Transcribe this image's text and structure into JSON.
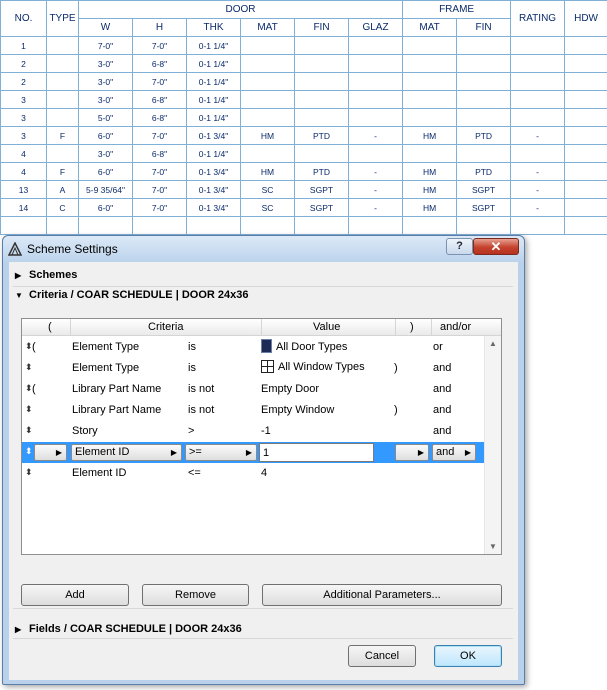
{
  "schedule": {
    "header_top": {
      "no": "NO.",
      "type": "TYPE",
      "door": "DOOR",
      "frame": "FRAME",
      "rating": "RATING",
      "hdw": "HDW"
    },
    "header_sub": [
      "W",
      "H",
      "THK",
      "MAT",
      "FIN",
      "GLAZ",
      "MAT",
      "FIN"
    ],
    "rows": [
      [
        "1",
        "",
        "7-0\"",
        "7-0\"",
        "0-1 1/4\"",
        "",
        "",
        "",
        "",
        "",
        "",
        ""
      ],
      [
        "2",
        "",
        "3-0\"",
        "6-8\"",
        "0-1 1/4\"",
        "",
        "",
        "",
        "",
        "",
        "",
        ""
      ],
      [
        "2",
        "",
        "3-0\"",
        "7-0\"",
        "0-1 1/4\"",
        "",
        "",
        "",
        "",
        "",
        "",
        ""
      ],
      [
        "3",
        "",
        "3-0\"",
        "6-8\"",
        "0-1 1/4\"",
        "",
        "",
        "",
        "",
        "",
        "",
        ""
      ],
      [
        "3",
        "",
        "5-0\"",
        "6-8\"",
        "0-1 1/4\"",
        "",
        "",
        "",
        "",
        "",
        "",
        ""
      ],
      [
        "3",
        "F",
        "6-0\"",
        "7-0\"",
        "0-1 3/4\"",
        "HM",
        "PTD",
        "-",
        "HM",
        "PTD",
        "-",
        ""
      ],
      [
        "4",
        "",
        "3-0\"",
        "6-8\"",
        "0-1 1/4\"",
        "",
        "",
        "",
        "",
        "",
        "",
        ""
      ],
      [
        "4",
        "F",
        "6-0\"",
        "7-0\"",
        "0-1 3/4\"",
        "HM",
        "PTD",
        "-",
        "HM",
        "PTD",
        "-",
        ""
      ],
      [
        "13",
        "A",
        "5-9 35/64\"",
        "7-0\"",
        "0-1 3/4\"",
        "SC",
        "SGPT",
        "-",
        "HM",
        "SGPT",
        "-",
        ""
      ],
      [
        "14",
        "C",
        "6-0\"",
        "7-0\"",
        "0-1 3/4\"",
        "SC",
        "SGPT",
        "-",
        "HM",
        "SGPT",
        "-",
        ""
      ],
      [
        "",
        "",
        "",
        "",
        "",
        "",
        "",
        "",
        "",
        "",
        "",
        ""
      ]
    ]
  },
  "dialog": {
    "title": "Scheme Settings",
    "help_label": "?",
    "close_label": "✕",
    "sections": {
      "schemes": "Schemes",
      "criteria": "Criteria /  COAR SCHEDULE | DOOR 24x36",
      "fields": "Fields /  COAR SCHEDULE | DOOR 24x36"
    },
    "list_header": {
      "open_paren": "(",
      "criteria": "Criteria",
      "value": "Value",
      "close_paren": ")",
      "andor": "and/or"
    },
    "rows": [
      {
        "open": "(",
        "field": "Element Type",
        "op": "is",
        "value": "All Door Types",
        "icon": "door-icon",
        "close": "",
        "andor": "or"
      },
      {
        "open": "",
        "field": "Element Type",
        "op": "is",
        "value": "All Window Types",
        "icon": "window-icon",
        "close": ")",
        "andor": "and"
      },
      {
        "open": "(",
        "field": "Library Part Name",
        "op": "is not",
        "value": "Empty Door",
        "icon": "",
        "close": "",
        "andor": "and"
      },
      {
        "open": "",
        "field": "Library Part Name",
        "op": "is not",
        "value": "Empty Window",
        "icon": "",
        "close": ")",
        "andor": "and"
      },
      {
        "open": "",
        "field": "Story",
        "op": ">",
        "value": "-1",
        "icon": "",
        "close": "",
        "andor": "and"
      },
      {
        "open": "",
        "field": "Element ID",
        "op": ">=",
        "value": "1",
        "icon": "",
        "close": "",
        "andor": "and"
      },
      {
        "open": "",
        "field": "Element ID",
        "op": "<=",
        "value": "4",
        "icon": "",
        "close": "",
        "andor": ""
      }
    ],
    "selected_row_index": 5,
    "buttons": {
      "add": "Add",
      "remove": "Remove",
      "additional": "Additional Parameters...",
      "cancel": "Cancel",
      "ok": "OK"
    }
  },
  "colors": {
    "selection": "#3399ff",
    "close_button": "#c4422e",
    "schedule_grid": "#7fb0d8",
    "schedule_text": "#0a2a6b"
  }
}
